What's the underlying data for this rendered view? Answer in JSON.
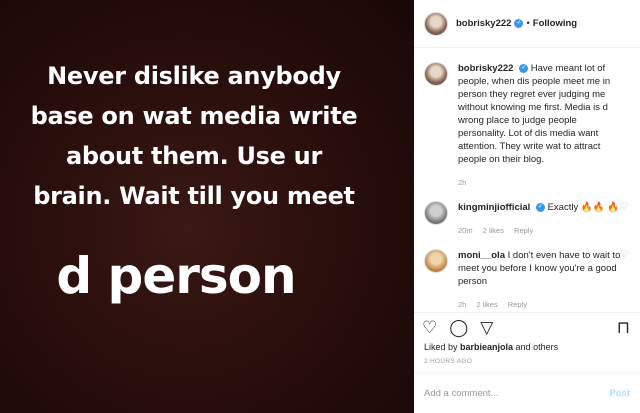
{
  "post": {
    "text_lines": [
      "Never dislike anybody",
      "base on wat media write",
      "about them. Use ur",
      "brain. Wait till you meet"
    ],
    "text_big": "d person"
  },
  "header": {
    "username": "bobrisky222",
    "separator": "•",
    "follow_status": "Following"
  },
  "comments": [
    {
      "username": "bobrisky222",
      "text": "Have meant lot of people, when dis people meet me in person they regret ever judging me without knowing me first. Media is d wrong place to judge people personality. Lot of dis media want attention. They write wat to attract people on their blog.",
      "time": "2h",
      "likes": "",
      "reply": ""
    },
    {
      "username": "kingminjiofficial",
      "text": "Exactly 🔥🔥 🔥",
      "time": "20m",
      "likes": "2 likes",
      "reply": "Reply"
    },
    {
      "username": "moni__ola",
      "text": "I don't even have to wait to meet you before I know you're a good person",
      "time": "2h",
      "likes": "2 likes",
      "reply": "Reply"
    }
  ],
  "likes": {
    "prefix": "Liked by ",
    "user": "barbieanjola",
    "suffix": " and others"
  },
  "time_ago": "2 HOURS AGO",
  "add_comment": {
    "placeholder": "Add a comment...",
    "post_label": "Post"
  },
  "icons": {
    "like": "heart-icon",
    "comment": "comment-icon",
    "share": "share-icon",
    "save": "bookmark-icon",
    "verified": "verified-badge-icon"
  },
  "colors": {
    "verified": "#3897f0",
    "post_disabled": "#b3dbff",
    "image_bg": "#2a0f0d"
  }
}
